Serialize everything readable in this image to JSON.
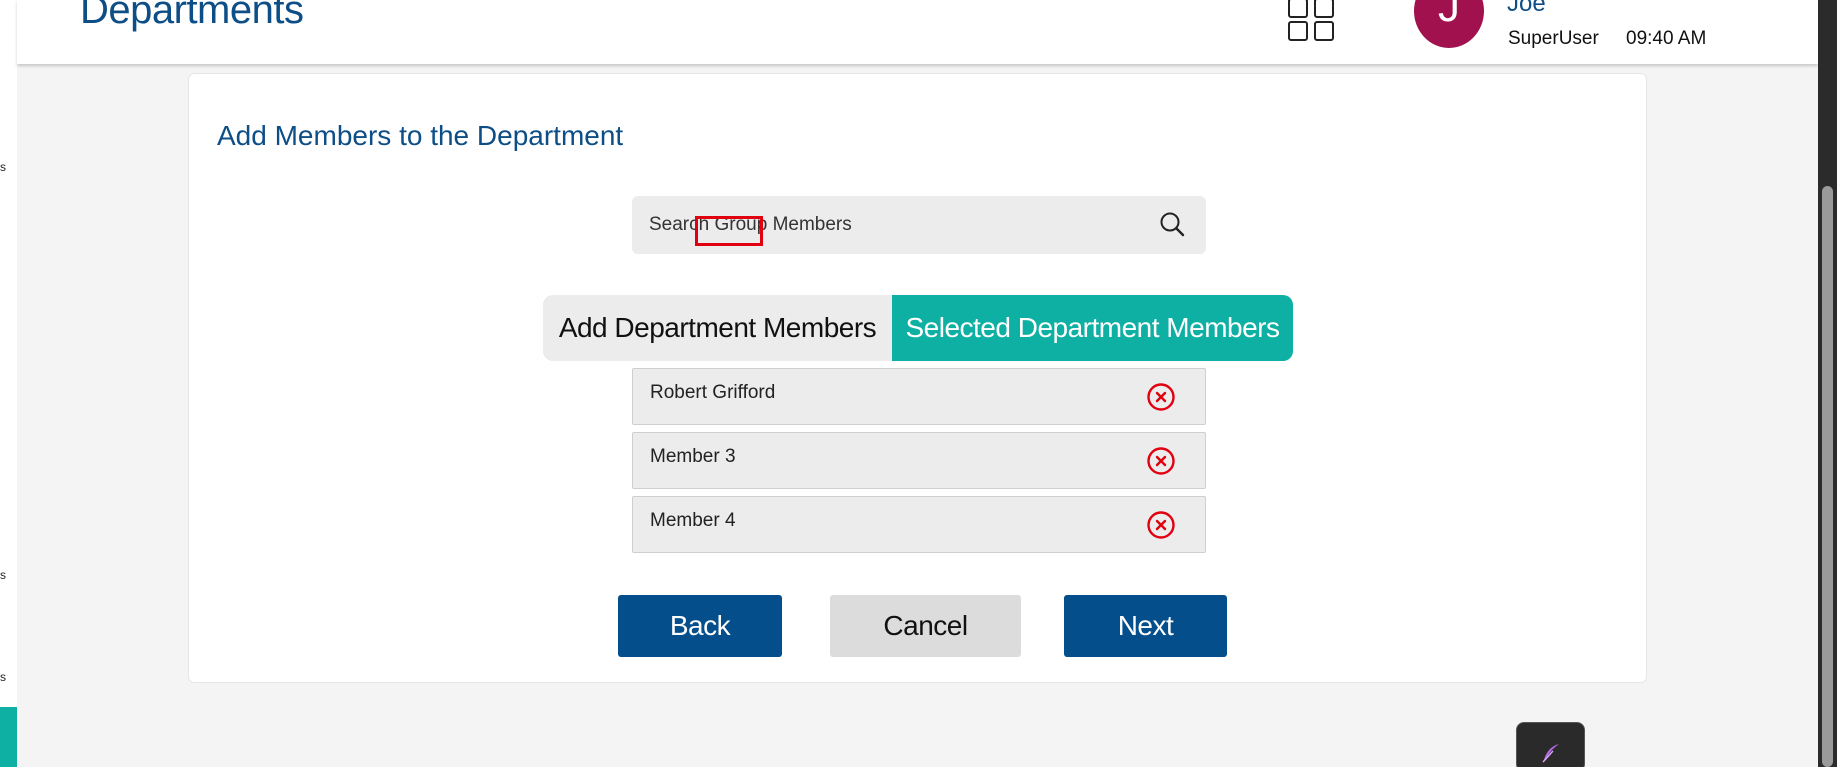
{
  "header": {
    "page_title": "Departments",
    "user": {
      "avatar_initial": "J",
      "name": "Joe",
      "role": "SuperUser",
      "time": "09:40 AM"
    }
  },
  "sidebar_fragments": [
    "s",
    "s",
    "s"
  ],
  "card": {
    "title": "Add Members to the Department",
    "search": {
      "placeholder": "Search Group Members"
    },
    "tabs": [
      {
        "label": "Add Department Members",
        "active": false
      },
      {
        "label": "Selected Department Members",
        "active": true
      }
    ],
    "members": [
      {
        "name": "Robert Grifford"
      },
      {
        "name": "Member 3"
      },
      {
        "name": "Member 4"
      }
    ],
    "buttons": {
      "back": "Back",
      "cancel": "Cancel",
      "next": "Next"
    }
  },
  "colors": {
    "brand_blue": "#0d4e86",
    "button_blue": "#044e8c",
    "teal": "#0fb0a4",
    "avatar": "#a0114e",
    "remove_red": "#e10010"
  },
  "icons": [
    "apps-grid-icon",
    "search-icon",
    "remove-circle-x-icon",
    "feather-icon"
  ]
}
